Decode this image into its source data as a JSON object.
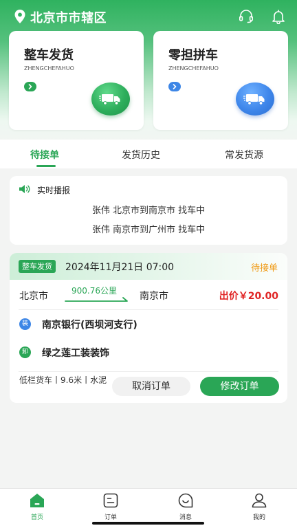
{
  "header": {
    "city": "北京市市辖区",
    "icons": [
      "location-pin-icon",
      "headset-icon",
      "bell-icon"
    ]
  },
  "services": [
    {
      "title": "整车发货",
      "subtitle": "ZHENGCHEFAHUO",
      "accent": "#2aa656",
      "icon": "truck-icon"
    },
    {
      "title": "零担拼车",
      "subtitle": "ZHENGCHEFAHUO",
      "accent": "#3d86e6",
      "icon": "truck-icon"
    }
  ],
  "tabs": [
    {
      "label": "待接单",
      "active": true
    },
    {
      "label": "发货历史",
      "active": false
    },
    {
      "label": "常发货源",
      "active": false
    }
  ],
  "broadcast": {
    "title": "实时播报",
    "lines": [
      "张伟 北京市到南京市 找车中",
      "张伟 南京市到广州市 找车中"
    ]
  },
  "order": {
    "tag": "整车发货",
    "datetime": "2024年11月21日 07:00",
    "status": "待接单",
    "from": "北京市",
    "distance": "900.76公里",
    "to": "南京市",
    "price": "出价￥20.00",
    "load_badge": "装",
    "load_address": "南京银行(西坝河支行)",
    "unload_badge": "卸",
    "unload_address": "绿之莲工装装饰",
    "cargo": "低栏货车丨9.6米丨水泥",
    "cancel_label": "取消订单",
    "edit_label": "修改订单"
  },
  "nav": [
    {
      "label": "首页",
      "icon": "home-icon",
      "active": true
    },
    {
      "label": "订单",
      "icon": "order-icon",
      "active": false
    },
    {
      "label": "消息",
      "icon": "message-icon",
      "active": false
    },
    {
      "label": "我的",
      "icon": "user-icon",
      "active": false
    }
  ],
  "colors": {
    "brand": "#2aa656",
    "blue": "#3d86e6",
    "price": "#e02424",
    "status": "#f09a16"
  }
}
